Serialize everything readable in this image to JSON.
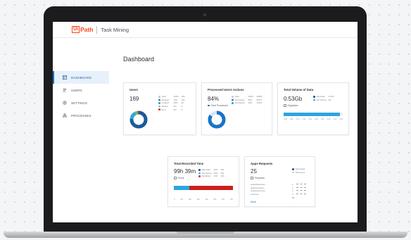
{
  "app": {
    "logo_prefix": "Ui",
    "logo_suffix": "Path",
    "name": "Task Mining"
  },
  "page_title": "Dashboard",
  "nav": [
    {
      "label": "DASHBOARD",
      "icon": "dashboard-icon",
      "active": true
    },
    {
      "label": "USERS",
      "icon": "users-icon",
      "active": false
    },
    {
      "label": "SETTINGS",
      "icon": "settings-icon",
      "active": false
    },
    {
      "label": "PROCESSES",
      "icon": "processes-icon",
      "active": false
    }
  ],
  "cards": {
    "users": {
      "title": "Users",
      "value": "169",
      "legend": [
        {
          "label": "Total",
          "pct": "100%",
          "count": "169",
          "color": "#c6cad0"
        },
        {
          "label": "Stopped",
          "pct": "79%",
          "count": "129",
          "color": "#1a5a9c"
        },
        {
          "label": "Created",
          "pct": "19%",
          "count": "26",
          "color": "#2ca5e0"
        },
        {
          "label": "Started",
          "pct": "5%",
          "count": "9",
          "color": "#5fc46a"
        },
        {
          "label": "Error",
          "pct": "3%",
          "count": "5",
          "color": "#e03a2f"
        }
      ],
      "donut_fractions": [
        0.763,
        0.154,
        0.053,
        0.03
      ]
    },
    "actions": {
      "title": "Processed Users Actions",
      "value": "84%",
      "sub_label": "Total Processed",
      "legend": [
        {
          "label": "Total",
          "pct": "100%",
          "count": "69950",
          "color": "#c6cad0"
        },
        {
          "label": "Processed",
          "pct": "84%",
          "count": "58797",
          "color": "#1a5a9c"
        },
        {
          "label": "Processing",
          "pct": "16%",
          "count": "11163",
          "color": "#2ca5e0"
        }
      ],
      "progress_fraction": 0.84
    },
    "volume": {
      "title": "Total Volume of Data",
      "value": "0.53Gb",
      "unit": "Gigabytes",
      "legend": [
        {
          "label": "Recorded",
          "pct": "0.01%",
          "color": "#1a5a9c"
        },
        {
          "label": "Net Volume",
          "pct": "4%",
          "color": "#2ca5e0"
        }
      ],
      "bar_fraction": 0.95,
      "axis": [
        "0.00",
        "0.05",
        "0.10",
        "0.15",
        "0.20",
        "0.25",
        "0.30",
        "0.35",
        "0.40",
        "0.45"
      ]
    },
    "time": {
      "title": "Total Recorded Time",
      "value": "99h 39m",
      "unit": "Hours",
      "legend": [
        {
          "label": "Recorded",
          "pct": "30%",
          "count": "30h",
          "color": "#1a5a9c"
        },
        {
          "label": "Net Volume",
          "pct": "26%",
          "count": "26h",
          "color": "#2ca5e0"
        },
        {
          "label": "Discarded",
          "pct": "44%",
          "count": "44h",
          "color": "#e03a2f"
        }
      ],
      "segments": [
        0.26,
        0.74
      ],
      "axis": [
        "0",
        "10h",
        "20h",
        "30h",
        "40h",
        "50h",
        "60h",
        "70h"
      ]
    },
    "apps": {
      "title": "Apps Requests",
      "value": "25",
      "unit": "Requests",
      "legend": [
        {
          "label": "Requested",
          "color": "#1a5a9c"
        },
        {
          "label": "Total users",
          "color": "#c6cad0"
        }
      ],
      "rows": [
        {
          "name": "outlooktaskmine...",
          "count": "4"
        },
        {
          "name": "applicationfram...",
          "count": "4"
        },
        {
          "name": "explorerhost.exe",
          "count": "3"
        },
        {
          "name": "excel.exe",
          "count": "3"
        }
      ],
      "total": "16",
      "more": "More"
    }
  }
}
